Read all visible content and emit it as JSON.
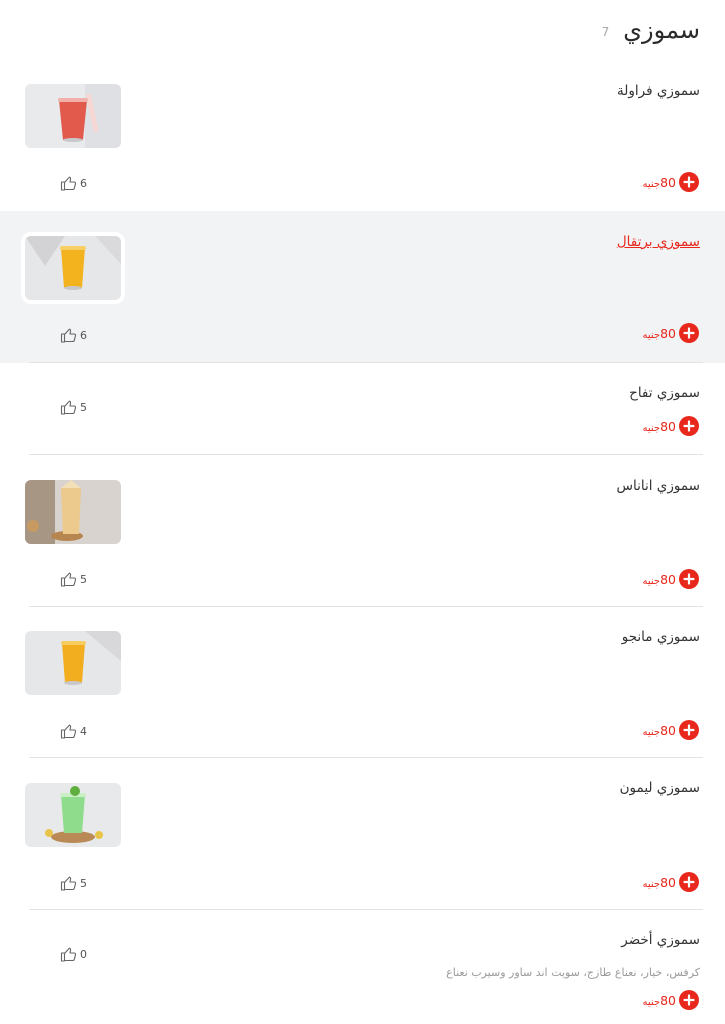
{
  "category": {
    "title": "سموزي",
    "count": "7"
  },
  "items": [
    {
      "name": "سموزي فراولة",
      "price": "80",
      "currency": "جنيه",
      "likes": "6"
    },
    {
      "name": "سموزي برتقال",
      "price": "80",
      "currency": "جنيه",
      "likes": "6"
    },
    {
      "name": "سموزي تفاح",
      "price": "80",
      "currency": "جنيه",
      "likes": "5"
    },
    {
      "name": "سموزي اناناس",
      "price": "80",
      "currency": "جنيه",
      "likes": "5"
    },
    {
      "name": "سموزي مانجو",
      "price": "80",
      "currency": "جنيه",
      "likes": "4"
    },
    {
      "name": "سموزي ليمون",
      "price": "80",
      "currency": "جنيه",
      "likes": "5"
    },
    {
      "name": "سموزي أخضر",
      "description": "كرفس، خيار، نعناع طازج، سويت اند ساور وسيرب نعناع",
      "price": "80",
      "currency": "جنيه",
      "likes": "0"
    }
  ],
  "colors": {
    "accent": "#e8281c",
    "highlight_bg": "#f2f3f5",
    "separator": "#e3e3e3"
  },
  "icons": {
    "add": "plus-circle-icon",
    "like": "thumbs-up-icon"
  }
}
